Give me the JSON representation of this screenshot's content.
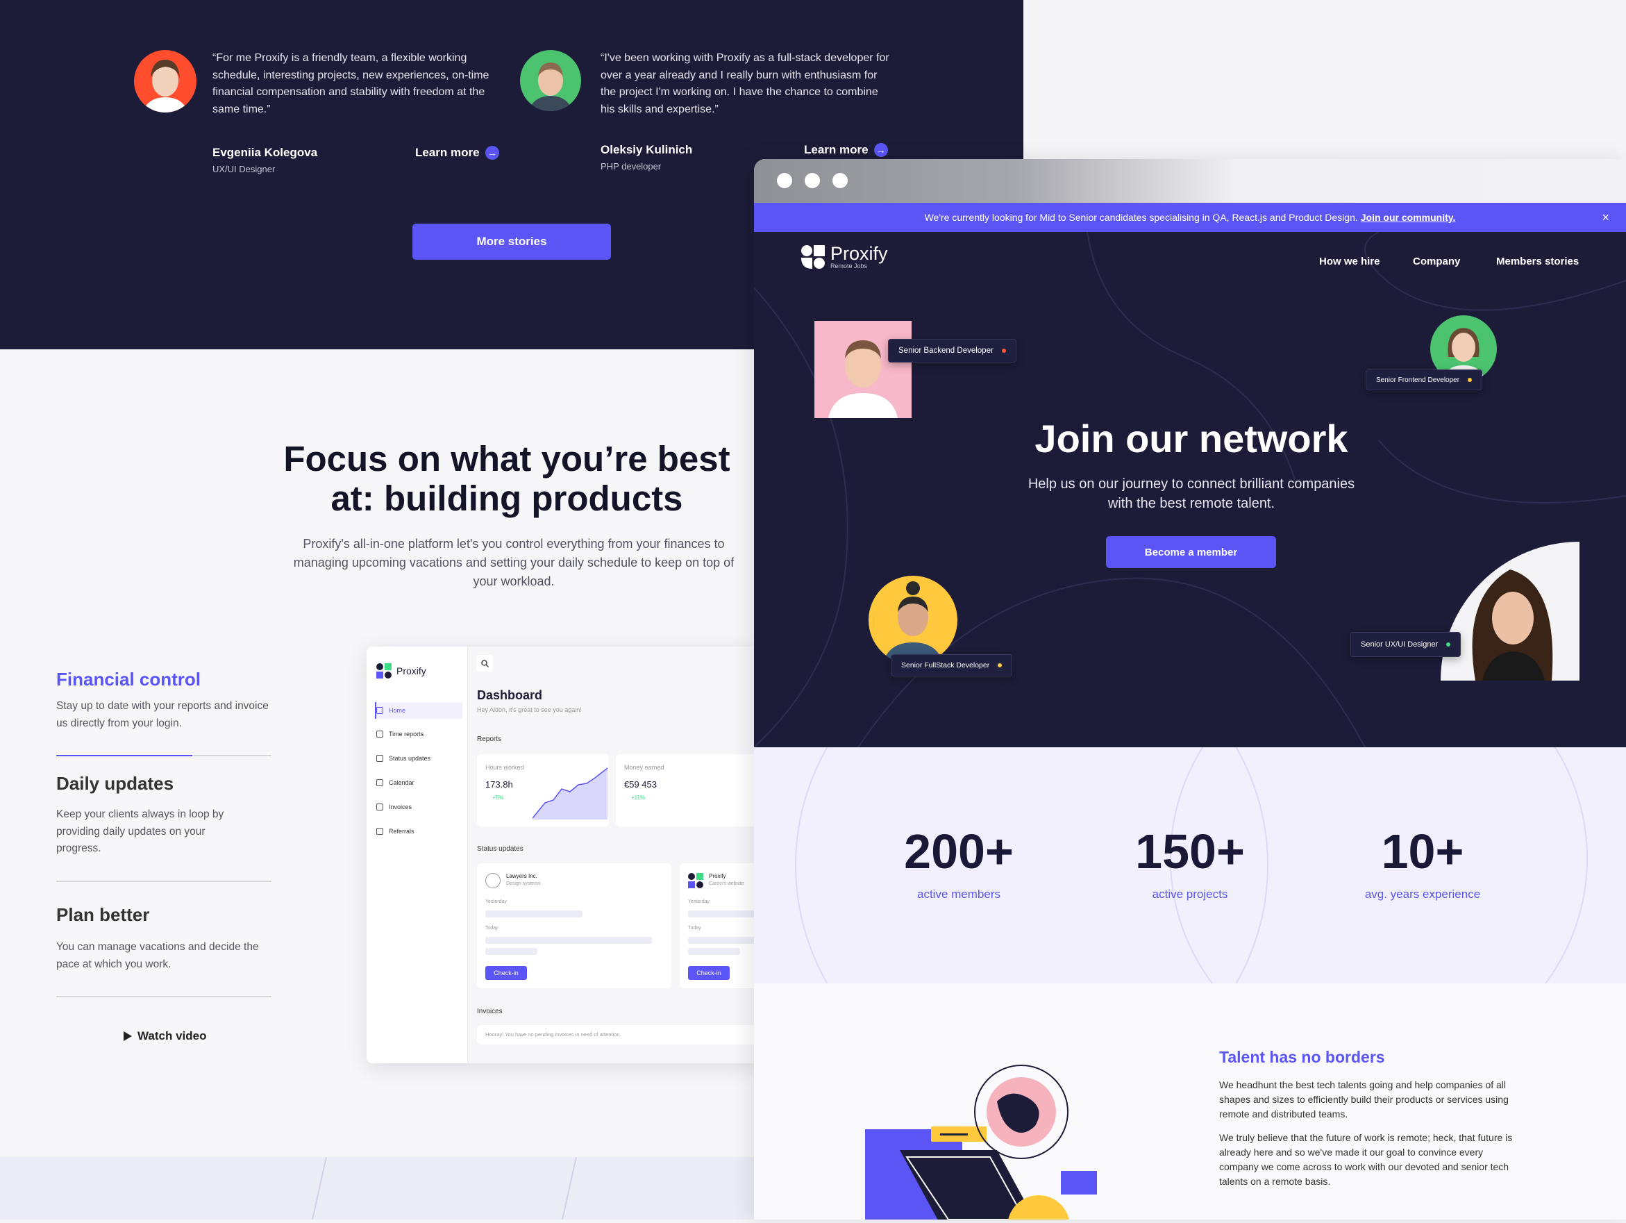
{
  "stories": {
    "quotes": [
      {
        "text": "“For me Proxify is a friendly team, a flexible working schedule, interesting projects, new experiences, on-time financial compensation and stability with freedom at the same time.”",
        "name": "Evgeniia Kolegova",
        "role": "UX/UI Designer",
        "link": "Learn more"
      },
      {
        "text": "“I've been working with Proxify as a full-stack developer for over a year already and I really burn with enthusiasm for the project I'm working on. I have the chance to combine his skills and expertise.”",
        "name": "Oleksiy Kulinich",
        "role": "PHP developer",
        "link": "Learn more"
      }
    ],
    "more_button": "More stories"
  },
  "focus": {
    "title_line1": "Focus on what you’re best",
    "title_line2": "at: building products",
    "description": "Proxify's all-in-one platform let's you control everything from your finances to managing upcoming vacations and setting your daily schedule to keep on top of your workload.",
    "features": [
      {
        "title": "Financial control",
        "desc": "Stay up to date with your reports and invoice us directly from your login."
      },
      {
        "title": "Daily updates",
        "desc": "Keep your clients always in loop by providing daily updates on your progress."
      },
      {
        "title": "Plan better",
        "desc": "You can manage vacations and decide the pace at which you work."
      }
    ],
    "watch_video": "Watch video"
  },
  "dashboard": {
    "brand": "Proxify",
    "nav": [
      "Home",
      "Time reports",
      "Status updates",
      "Calendar",
      "Invoices",
      "Referrals"
    ],
    "title": "Dashboard",
    "greeting": "Hey Aldon, it's great to see you again!",
    "reports_label": "Reports",
    "hours_label": "Hours worked",
    "hours_value": "173.8h",
    "hours_change": "+5%",
    "money_label": "Money earned",
    "money_value": "€59 453",
    "money_change": "+11%",
    "status_label": "Status updates",
    "status_cards": [
      {
        "company": "Lawyers Inc.",
        "sub": "Design systems",
        "yesterday": "Yesterday",
        "today": "Today",
        "button": "Check-in"
      },
      {
        "company": "Proxify",
        "sub": "Careers website",
        "yesterday": "Yesterday",
        "today": "Today",
        "button": "Check-in"
      }
    ],
    "invoices_label": "Invoices",
    "invoices_text": "Hooray! You have no pending invoices in need of attention."
  },
  "browser": {
    "banner_text": "We're currently looking for Mid to Senior candidates specialising in QA, React.js and Product Design.",
    "banner_link": "Join our community.",
    "banner_close": "×",
    "logo_name": "Proxify",
    "logo_sub": "Remote Jobs",
    "nav": [
      "How we hire",
      "Company",
      "Members stories"
    ],
    "hero_title": "Join our network",
    "hero_sub_line1": "Help us on our journey to connect brilliant companies",
    "hero_sub_line2": "with the best remote talent.",
    "cta": "Become a member",
    "tags": [
      "Senior Backend Developer",
      "Senior Frontend Developer",
      "Senior FullStack Developer",
      "Senior UX/UI Designer"
    ],
    "stats": [
      {
        "value": "200+",
        "label": "active members"
      },
      {
        "value": "150+",
        "label": "active projects"
      },
      {
        "value": "10+",
        "label": "avg. years experience"
      }
    ],
    "talent_title": "Talent has no borders",
    "talent_p1": "We headhunt the best tech talents going and help companies of all shapes and sizes to efficiently build their products or services using remote and distributed teams.",
    "talent_p2": "We truly believe that the future of work is remote; heck, that future is already here and so we've made it our goal to convince every company we come across to work with our devoted and senior tech talents on a remote basis."
  },
  "colors": {
    "accent": "#5b55f5",
    "dark": "#1c1c38",
    "tag_dot_red": "#ff5a36",
    "tag_dot_yellow": "#ffc83d",
    "tag_dot_green": "#3ddc84"
  }
}
